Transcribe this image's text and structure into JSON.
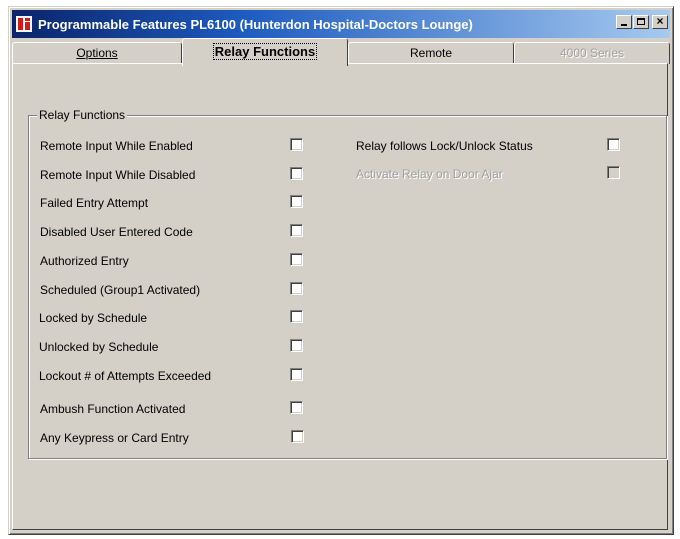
{
  "window": {
    "title": "Programmable Features PL6100 (Hunterdon Hospital-Doctors Lounge)",
    "buttons": {
      "minimize": "_",
      "maximize": "□",
      "close": "×"
    }
  },
  "tabs": [
    {
      "label": "Options",
      "state": "normal"
    },
    {
      "label": "Relay Functions",
      "state": "active"
    },
    {
      "label": "Remote",
      "state": "normal"
    },
    {
      "label": "4000 Series",
      "state": "disabled"
    }
  ],
  "group": {
    "title": "Relay Functions",
    "left_items": [
      {
        "label": "Remote Input While Enabled",
        "checked": false
      },
      {
        "label": "Remote Input While Disabled",
        "checked": false
      },
      {
        "label": "Failed Entry Attempt",
        "checked": false
      },
      {
        "label": "Disabled User Entered Code",
        "checked": false
      },
      {
        "label": "Authorized Entry",
        "checked": false
      },
      {
        "label": "Scheduled (Group1 Activated)",
        "checked": false
      },
      {
        "label": "Locked by Schedule",
        "checked": false
      },
      {
        "label": "Unlocked by Schedule",
        "checked": false
      },
      {
        "label": "Lockout # of Attempts Exceeded",
        "checked": false
      },
      {
        "label": "Ambush Function Activated",
        "checked": false
      },
      {
        "label": "Any Keypress or Card Entry",
        "checked": false
      }
    ],
    "right_items": [
      {
        "label": "Relay follows Lock/Unlock Status",
        "checked": false,
        "enabled": true
      },
      {
        "label": "Activate Relay on Door Ajar",
        "checked": false,
        "enabled": false
      }
    ]
  },
  "colors": {
    "face": "#d4d0c8",
    "title_gradient_start": "#0a246a",
    "title_gradient_end": "#a6caf0",
    "disabled_text": "#a0a0a0"
  }
}
